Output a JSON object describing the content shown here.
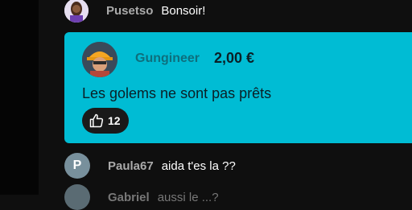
{
  "messages": [
    {
      "author": "Pusetso",
      "text": "Bonsoir!"
    },
    {
      "author": "Paula67",
      "text": "aida t'es la ??",
      "avatar_letter": "P"
    },
    {
      "author": "Gabriel",
      "text": "aussi le ...?"
    }
  ],
  "superchat": {
    "author": "Gungineer",
    "amount": "2,00 €",
    "text": "Les golems ne sont pas prêts",
    "likes": "12",
    "color": "#00bcd4"
  },
  "icons": [
    "thumbs-up-icon"
  ]
}
